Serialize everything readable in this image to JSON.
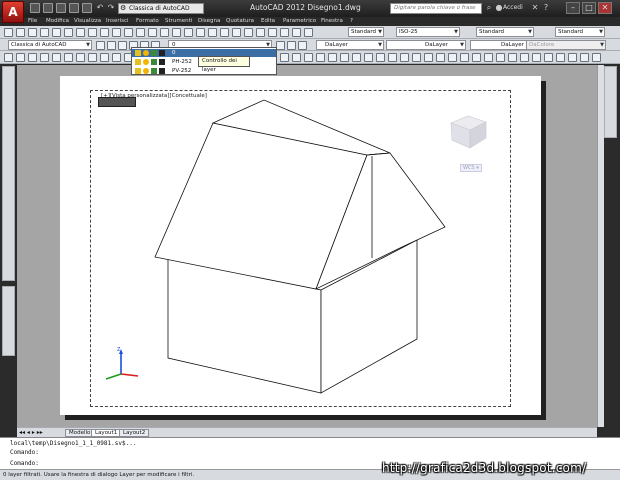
{
  "titlebar": {
    "app_button": "A",
    "workspace": "Classica di AutoCAD",
    "title": "AutoCAD 2012   Disegno1.dwg",
    "search_placeholder": "Digitare parola chiave o frase",
    "login": "Accedi"
  },
  "menu": [
    "File",
    "Modifica",
    "Visualizza",
    "Inserisci",
    "Formato",
    "Strumenti",
    "Disegna",
    "Quotatura",
    "Edita",
    "Parametrico",
    "Finestra",
    "?"
  ],
  "toolbar2": {
    "workspace_dd": "Classica di AutoCAD",
    "text_style": "Standard",
    "dim_style": "ISO-25",
    "table_style": "Standard",
    "multileader_style": "Standard",
    "layer_current": "0"
  },
  "toolbar3": {
    "color": "DaLayer",
    "linetype": "DaLayer",
    "lineweight": "DaLayer",
    "plotstyle": "DaColore"
  },
  "layer_list": {
    "items": [
      "0",
      "PH-252",
      "PV-252"
    ],
    "tooltip": "Controllo dei layer"
  },
  "viewport": {
    "label": "[+][Vista personalizzata][Concettuale]",
    "wcs": "WCS ▾"
  },
  "tabs": [
    "Modello",
    "Layout1",
    "Layout2"
  ],
  "command": {
    "history": "local\\temp\\Disegno1_1_1_0981.sv$...",
    "line2": "Comando:",
    "line3": "Comando:"
  },
  "status": "0 layer filtrati. Usare la finestra di dialogo Layer per modificare i filtri.",
  "watermark_url": "http://grafica2d3d.blogspot.com/"
}
